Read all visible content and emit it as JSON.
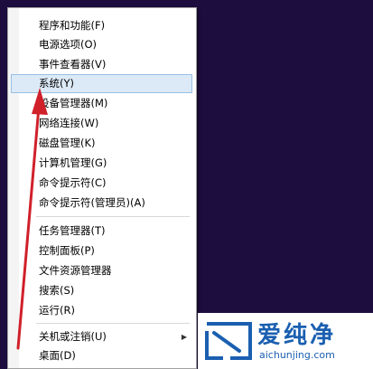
{
  "menu": {
    "items": [
      {
        "label": "程序和功能(F)"
      },
      {
        "label": "电源选项(O)"
      },
      {
        "label": "事件查看器(V)"
      },
      {
        "label": "系统(Y)"
      },
      {
        "label": "设备管理器(M)"
      },
      {
        "label": "网络连接(W)"
      },
      {
        "label": "磁盘管理(K)"
      },
      {
        "label": "计算机管理(G)"
      },
      {
        "label": "命令提示符(C)"
      },
      {
        "label": "命令提示符(管理员)(A)"
      },
      {
        "label": "任务管理器(T)"
      },
      {
        "label": "控制面板(P)"
      },
      {
        "label": "文件资源管理器"
      },
      {
        "label": "搜索(S)"
      },
      {
        "label": "运行(R)"
      },
      {
        "label": "关机或注销(U)",
        "submenu_arrow": "▶"
      },
      {
        "label": "桌面(D)"
      }
    ],
    "highlighted": "系统(Y)"
  },
  "logo": {
    "text": "爱纯净",
    "url": "aichunjing.com"
  },
  "colors": {
    "desktop": "#1d0c3e",
    "highlight": "#dceaf7",
    "highlight_border": "#98bfe4",
    "annotation_arrow": "#d0202a",
    "logo_blue": "#1a5fb0"
  },
  "icons": {
    "annotation": "red-pointer-arrow",
    "logo": "aichunjing-logo-icon"
  }
}
